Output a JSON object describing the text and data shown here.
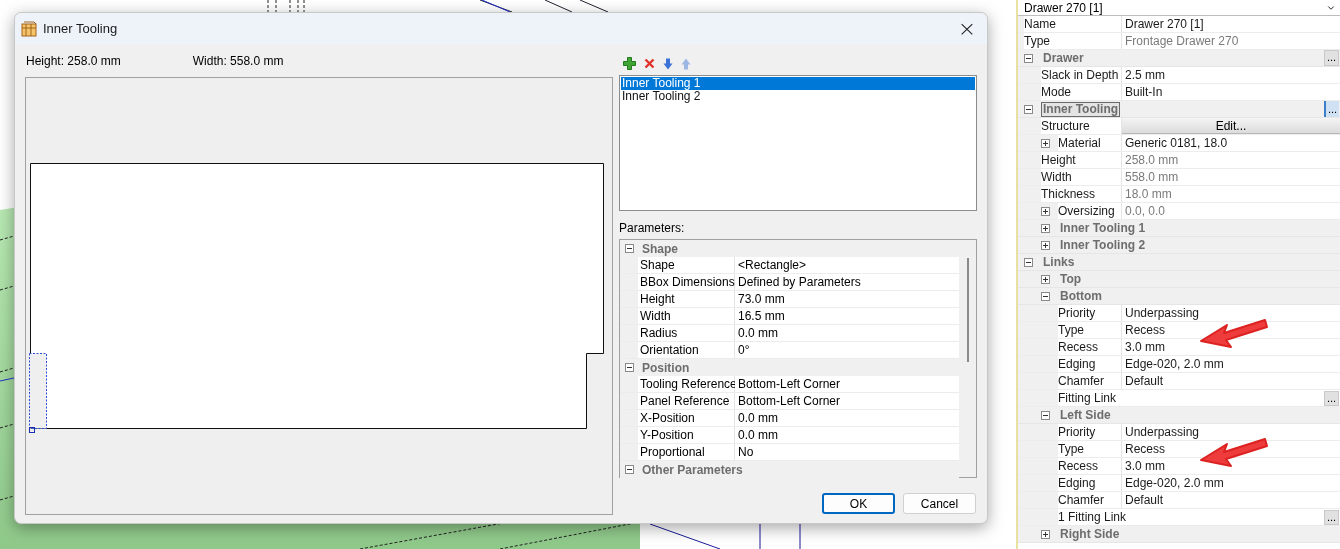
{
  "dialog": {
    "title": "Inner Tooling",
    "close": "×",
    "height_label": "Height: 258.0 mm",
    "width_label": "Width: 558.0 mm",
    "toolbar": [
      {
        "kind": "add",
        "disabled": false
      },
      {
        "kind": "delete",
        "disabled": false
      },
      {
        "kind": "down",
        "disabled": false
      },
      {
        "kind": "up",
        "disabled": true
      }
    ],
    "list": [
      {
        "label": "Inner Tooling 1",
        "selected": true
      },
      {
        "label": "Inner Tooling 2",
        "selected": false
      }
    ],
    "parameters_label": "Parameters:",
    "sections": [
      {
        "title": "Shape",
        "expanded": true,
        "rows": [
          {
            "label": "Shape",
            "value": "<Rectangle>"
          },
          {
            "label": "BBox Dimensions",
            "value": "Defined by Parameters"
          },
          {
            "label": "Height",
            "value": "73.0 mm"
          },
          {
            "label": "Width",
            "value": "16.5 mm"
          },
          {
            "label": "Radius",
            "value": "0.0 mm"
          },
          {
            "label": "Orientation",
            "value": "0°"
          }
        ]
      },
      {
        "title": "Position",
        "expanded": true,
        "rows": [
          {
            "label": "Tooling Reference",
            "value": "Bottom-Left Corner"
          },
          {
            "label": "Panel Reference",
            "value": "Bottom-Left Corner"
          },
          {
            "label": "X-Position",
            "value": "0.0 mm"
          },
          {
            "label": "Y-Position",
            "value": "0.0 mm"
          },
          {
            "label": "Proportional",
            "value": "No"
          }
        ]
      },
      {
        "title": "Other Parameters",
        "expanded": true
      }
    ],
    "buttons": [
      {
        "label": "OK",
        "default": true
      },
      {
        "label": "Cancel",
        "default": false
      }
    ]
  },
  "property_panel": {
    "header": "Drawer 270 [1]",
    "rows": [
      {
        "kind": "property",
        "label": "Name",
        "value": "Drawer 270 [1]",
        "readonly": false
      },
      {
        "kind": "property",
        "label": "Type",
        "value": "Frontage Drawer 270",
        "readonly": true
      },
      {
        "kind": "group",
        "label": "Drawer",
        "expanded": true,
        "focused": false,
        "ellipsis": "...",
        "children": [
          {
            "kind": "property",
            "label": "Slack in Depth",
            "value": "2.5 mm",
            "readonly": false
          },
          {
            "kind": "property",
            "label": "Mode",
            "value": "Built-In",
            "readonly": false
          }
        ]
      },
      {
        "kind": "group",
        "label": "Inner Tooling",
        "expanded": true,
        "focused": true,
        "ellipsis": "...",
        "children": [
          {
            "kind": "button",
            "label": "Structure",
            "button": "Edit..."
          },
          {
            "kind": "expandable",
            "label": "Material",
            "value": "Generic 0181, 18.0",
            "expanded": false,
            "readonly": false
          },
          {
            "kind": "property",
            "label": "Height",
            "value": "258.0 mm",
            "readonly": true
          },
          {
            "kind": "property",
            "label": "Width",
            "value": "558.0 mm",
            "readonly": true
          },
          {
            "kind": "property",
            "label": "Thickness",
            "value": "18.0 mm",
            "readonly": true
          },
          {
            "kind": "expandable",
            "label": "Oversizing",
            "value": "0.0, 0.0",
            "expanded": false,
            "readonly": true
          },
          {
            "kind": "group",
            "label": "Inner Tooling 1",
            "expanded": false,
            "focused": false
          },
          {
            "kind": "group",
            "label": "Inner Tooling 2",
            "expanded": false,
            "focused": false
          }
        ]
      },
      {
        "kind": "group",
        "label": "Links",
        "expanded": true,
        "focused": false,
        "children": [
          {
            "kind": "group",
            "label": "Top",
            "expanded": false,
            "focused": false
          },
          {
            "kind": "group",
            "label": "Bottom",
            "expanded": true,
            "focused": false,
            "children": [
              {
                "kind": "property",
                "label": "Priority",
                "value": "Underpassing",
                "readonly": false
              },
              {
                "kind": "property",
                "label": "Type",
                "value": "Recess",
                "readonly": false
              },
              {
                "kind": "property",
                "label": "Recess",
                "value": "3.0 mm",
                "readonly": false
              },
              {
                "kind": "property",
                "label": "Edging",
                "value": "Edge-020, 2.0 mm",
                "readonly": false
              },
              {
                "kind": "property",
                "label": "Chamfer",
                "value": "Default",
                "readonly": false
              },
              {
                "kind": "link",
                "label": "Fitting Link",
                "ellipsis": "..."
              }
            ]
          },
          {
            "kind": "group",
            "label": "Left Side",
            "expanded": true,
            "focused": false,
            "children": [
              {
                "kind": "property",
                "label": "Priority",
                "value": "Underpassing",
                "readonly": false
              },
              {
                "kind": "property",
                "label": "Type",
                "value": "Recess",
                "readonly": false
              },
              {
                "kind": "property",
                "label": "Recess",
                "value": "3.0 mm",
                "readonly": false
              },
              {
                "kind": "property",
                "label": "Edging",
                "value": "Edge-020, 2.0 mm",
                "readonly": false
              },
              {
                "kind": "property",
                "label": "Chamfer",
                "value": "Default",
                "readonly": false
              },
              {
                "kind": "link",
                "label": "1 Fitting Link",
                "ellipsis": "..."
              }
            ]
          },
          {
            "kind": "group",
            "label": "Right Side",
            "expanded": false,
            "focused": false
          }
        ]
      }
    ]
  }
}
